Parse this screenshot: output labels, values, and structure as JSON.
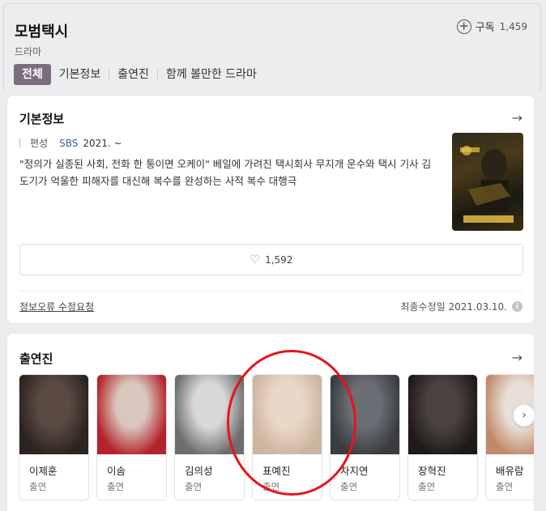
{
  "header": {
    "title": "모범택시",
    "subtitle": "드라마",
    "subscribe_label": "구독",
    "subscribe_count": "1,459",
    "tabs": [
      "전체",
      "기본정보",
      "출연진",
      "함께 볼만한 드라마"
    ]
  },
  "info": {
    "title": "기본정보",
    "meta_label": "편성",
    "channel": "SBS",
    "date": "2021. ~",
    "description": "\"정의가 실종된 사회, 전화 한 통이면 오케이\" 베일에 가려진 택시회사 무지개 운수와 택시 기사 김도기가 억울한 피해자를 대신해 복수를 완성하는 사적 복수 대행극",
    "likes": "1,592",
    "report_label": "정보오류 수정요청",
    "updated": "최종수정일 2021.03.10."
  },
  "cast": {
    "title": "출연진",
    "items": [
      {
        "name": "이제훈",
        "role": "출연",
        "color1": "#5a4a42",
        "color2": "#2c2420"
      },
      {
        "name": "이솜",
        "role": "출연",
        "color1": "#d9c6bc",
        "color2": "#b4232a"
      },
      {
        "name": "김의성",
        "role": "출연",
        "color1": "#d8d8d8",
        "color2": "#6e6e6e"
      },
      {
        "name": "표예진",
        "role": "출연",
        "color1": "#e9d8c8",
        "color2": "#cdb59f"
      },
      {
        "name": "차지연",
        "role": "출연",
        "color1": "#6a6e74",
        "color2": "#3a3c40"
      },
      {
        "name": "장혁진",
        "role": "출연",
        "color1": "#4a4240",
        "color2": "#1f1a18"
      },
      {
        "name": "배유람",
        "role": "출연",
        "color1": "#e8e0d8",
        "color2": "#c08a6a"
      }
    ]
  },
  "colors": {
    "accent_tab": "#7b6c7e",
    "channel_link": "#3563b3",
    "highlight": "#e8141a"
  }
}
